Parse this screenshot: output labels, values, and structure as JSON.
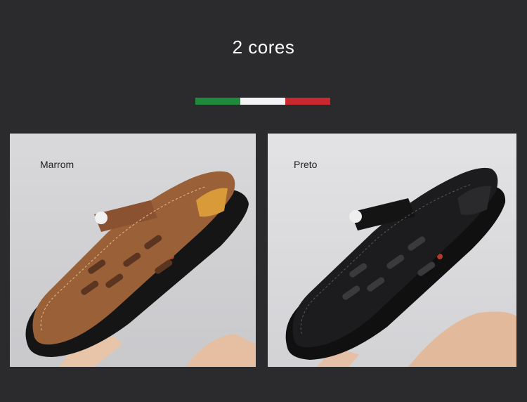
{
  "header": {
    "title": "2 cores"
  },
  "flag": {
    "colors": [
      "#1f8a3c",
      "#f4f4f4",
      "#c8282e"
    ]
  },
  "variants": [
    {
      "label": "Marrom",
      "color": "#9a6038"
    },
    {
      "label": "Preto",
      "color": "#1c1c1e"
    }
  ]
}
